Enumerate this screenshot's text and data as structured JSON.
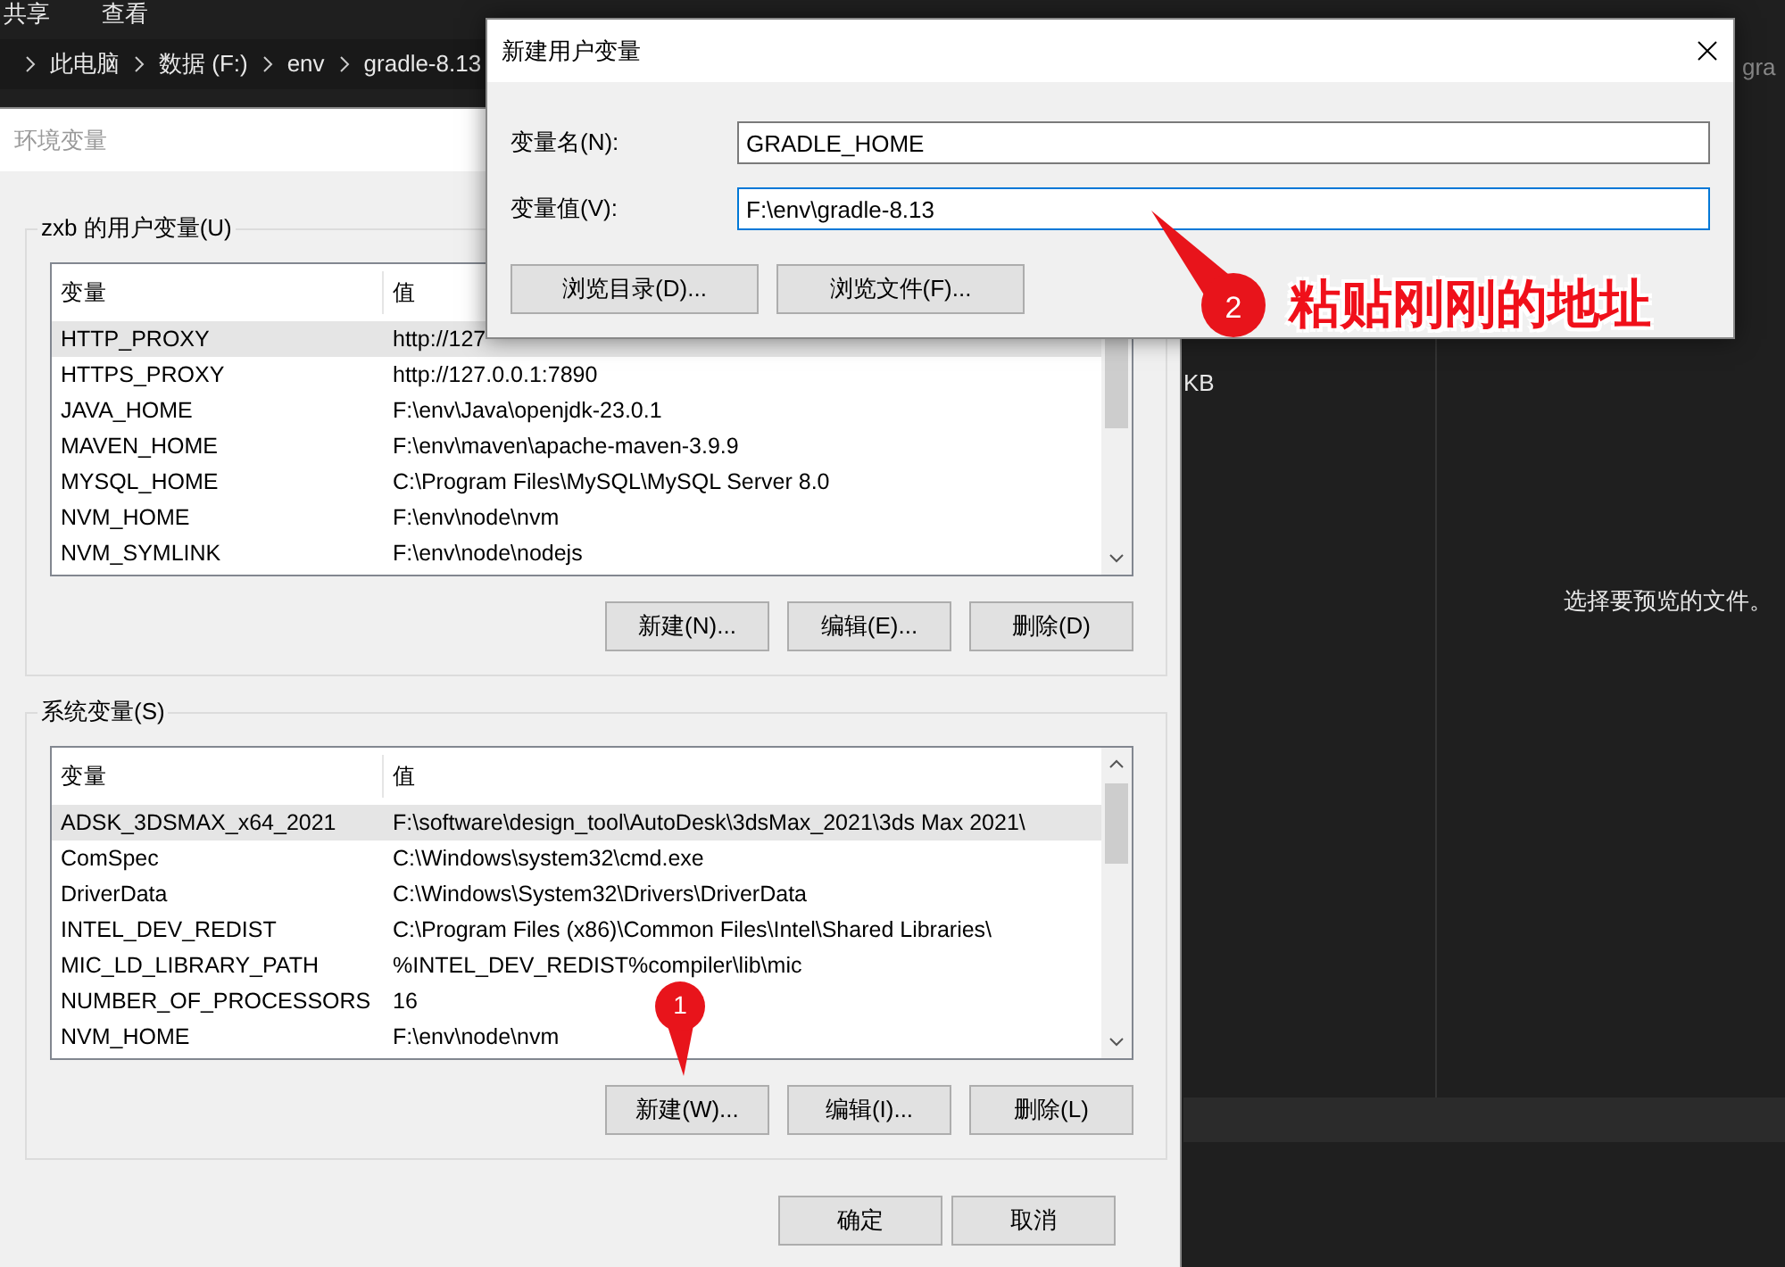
{
  "explorer": {
    "menu": [
      "共享",
      "查看"
    ],
    "breadcrumb": [
      "此电脑",
      "数据 (F:)",
      "env",
      "gradle-8.13"
    ],
    "search_text": "gra",
    "file_sizes": [
      "KB"
    ],
    "preview_message": "选择要预览的文件。"
  },
  "env_dialog": {
    "title": "环境变量",
    "groups": [
      {
        "label": "zxb 的用户变量(U)",
        "columns": [
          "变量",
          "值"
        ],
        "rows": [
          {
            "name": "HTTP_PROXY",
            "value": "http://127",
            "selected": true
          },
          {
            "name": "HTTPS_PROXY",
            "value": "http://127.0.0.1:7890",
            "selected": false
          },
          {
            "name": "JAVA_HOME",
            "value": "F:\\env\\Java\\openjdk-23.0.1",
            "selected": false
          },
          {
            "name": "MAVEN_HOME",
            "value": "F:\\env\\maven\\apache-maven-3.9.9",
            "selected": false
          },
          {
            "name": "MYSQL_HOME",
            "value": "C:\\Program Files\\MySQL\\MySQL Server 8.0",
            "selected": false
          },
          {
            "name": "NVM_HOME",
            "value": "F:\\env\\node\\nvm",
            "selected": false
          },
          {
            "name": "NVM_SYMLINK",
            "value": "F:\\env\\node\\nodejs",
            "selected": false
          }
        ],
        "buttons": [
          "新建(N)...",
          "编辑(E)...",
          "删除(D)"
        ]
      },
      {
        "label": "系统变量(S)",
        "columns": [
          "变量",
          "值"
        ],
        "rows": [
          {
            "name": "ADSK_3DSMAX_x64_2021",
            "value": "F:\\software\\design_tool\\AutoDesk\\3dsMax_2021\\3ds Max 2021\\",
            "selected": true
          },
          {
            "name": "ComSpec",
            "value": "C:\\Windows\\system32\\cmd.exe",
            "selected": false
          },
          {
            "name": "DriverData",
            "value": "C:\\Windows\\System32\\Drivers\\DriverData",
            "selected": false
          },
          {
            "name": "INTEL_DEV_REDIST",
            "value": "C:\\Program Files (x86)\\Common Files\\Intel\\Shared Libraries\\",
            "selected": false
          },
          {
            "name": "MIC_LD_LIBRARY_PATH",
            "value": "%INTEL_DEV_REDIST%compiler\\lib\\mic",
            "selected": false
          },
          {
            "name": "NUMBER_OF_PROCESSORS",
            "value": "16",
            "selected": false
          },
          {
            "name": "NVM_HOME",
            "value": "F:\\env\\node\\nvm",
            "selected": false
          }
        ],
        "buttons": [
          "新建(W)...",
          "编辑(I)...",
          "删除(L)"
        ]
      }
    ],
    "buttons": [
      "确定",
      "取消"
    ]
  },
  "new_dialog": {
    "title": "新建用户变量",
    "fields": [
      {
        "label": "变量名(N):",
        "value": "GRADLE_HOME",
        "focused": false
      },
      {
        "label": "变量值(V):",
        "value": "F:\\env\\gradle-8.13",
        "focused": true
      }
    ],
    "buttons": [
      "浏览目录(D)...",
      "浏览文件(F)..."
    ]
  },
  "annotations": [
    {
      "number": "1"
    },
    {
      "number": "2",
      "text": "粘贴刚刚的地址"
    }
  ]
}
